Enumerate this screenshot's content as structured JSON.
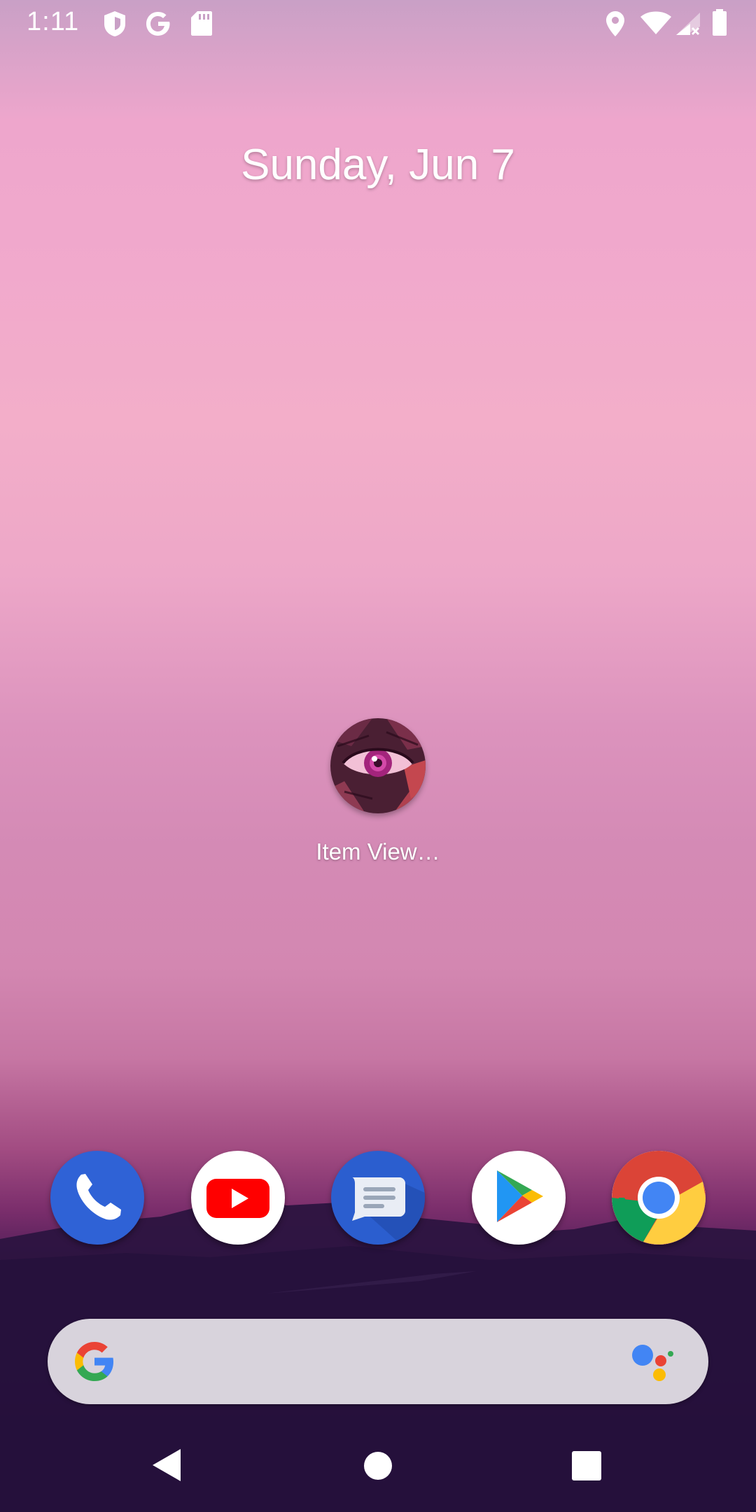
{
  "status_bar": {
    "time": "1:11",
    "icons": [
      "shield-icon",
      "google-g-icon",
      "sd-card-icon",
      "location-icon",
      "wifi-icon",
      "cell-signal-icon",
      "battery-icon"
    ]
  },
  "home": {
    "date": "Sunday, Jun 7",
    "apps": [
      {
        "label": "Item View…",
        "icon": "eye-artwork-icon"
      }
    ]
  },
  "dock": {
    "apps": [
      "phone-icon",
      "youtube-icon",
      "messages-icon",
      "play-store-icon",
      "chrome-icon"
    ]
  },
  "search": {
    "placeholder": "",
    "icons": [
      "google-logo-icon",
      "assistant-icon"
    ]
  },
  "nav_bar": {
    "buttons": [
      "back-icon",
      "home-icon",
      "recents-icon"
    ]
  },
  "colors": {
    "search_bg": "#d8d3dc",
    "phone_blue": "#2f62d6",
    "youtube_red": "#ff0000",
    "messages_blue": "#2b5ecf"
  }
}
